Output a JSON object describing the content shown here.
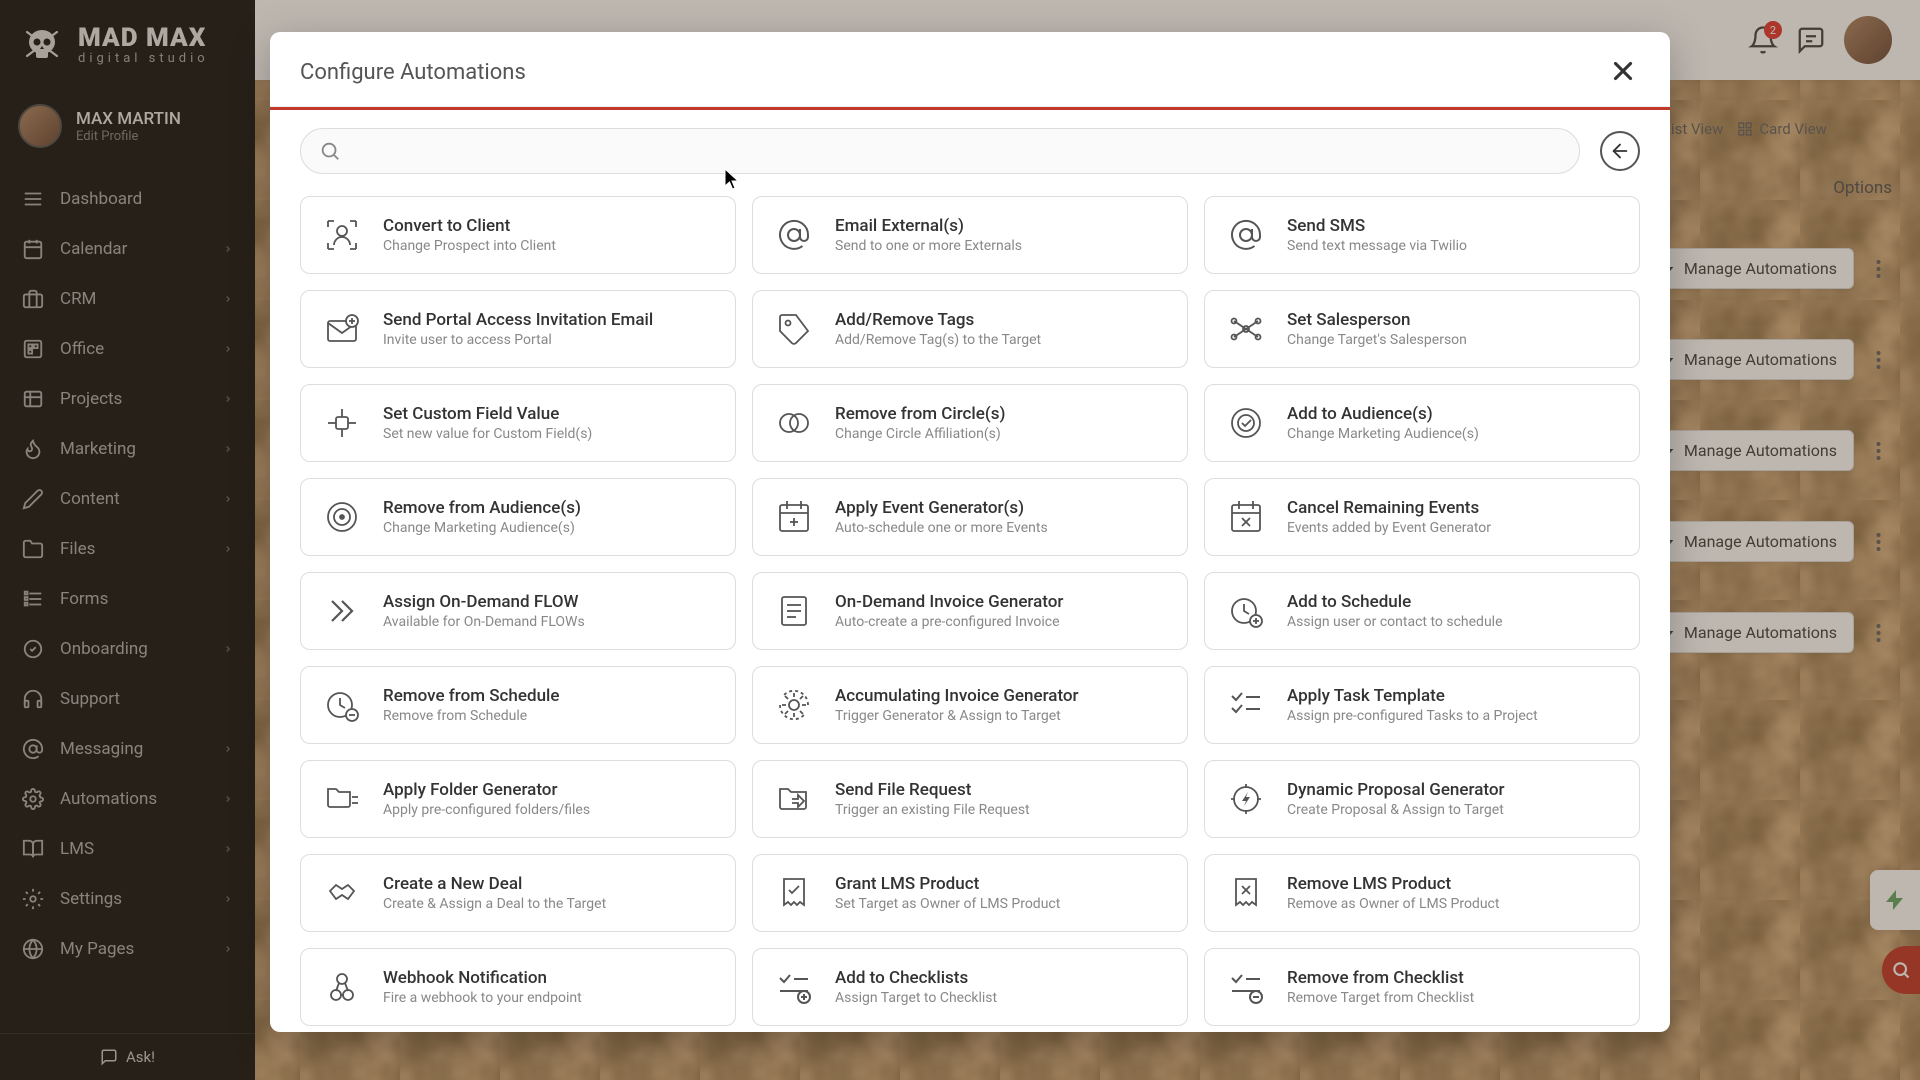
{
  "brand": {
    "name": "MAD MAX",
    "tagline": "digital studio"
  },
  "profile": {
    "name": "MAX MARTIN",
    "edit": "Edit Profile"
  },
  "sidebar": {
    "items": [
      {
        "label": "Dashboard",
        "icon": "menu",
        "chev": false
      },
      {
        "label": "Calendar",
        "icon": "calendar",
        "chev": true
      },
      {
        "label": "CRM",
        "icon": "crm",
        "chev": true
      },
      {
        "label": "Office",
        "icon": "office",
        "chev": true
      },
      {
        "label": "Projects",
        "icon": "projects",
        "chev": true
      },
      {
        "label": "Marketing",
        "icon": "flame",
        "chev": true
      },
      {
        "label": "Content",
        "icon": "pencil",
        "chev": true
      },
      {
        "label": "Files",
        "icon": "folder",
        "chev": true
      },
      {
        "label": "Forms",
        "icon": "forms",
        "chev": false
      },
      {
        "label": "Onboarding",
        "icon": "onboarding",
        "chev": true
      },
      {
        "label": "Support",
        "icon": "headset",
        "chev": false
      },
      {
        "label": "Messaging",
        "icon": "at",
        "chev": true
      },
      {
        "label": "Automations",
        "icon": "gear",
        "chev": true
      },
      {
        "label": "LMS",
        "icon": "book",
        "chev": true
      },
      {
        "label": "Settings",
        "icon": "cog",
        "chev": true
      },
      {
        "label": "My Pages",
        "icon": "globe",
        "chev": true
      }
    ],
    "ask": "Ask!"
  },
  "topbar": {
    "notif_count": "2"
  },
  "background_list": {
    "list_view": "List View",
    "card_view": "Card View",
    "options": "Options",
    "manage": "Manage Automations"
  },
  "modal": {
    "title": "Configure Automations",
    "search_placeholder": "",
    "cards": [
      {
        "title": "Convert to Client",
        "desc": "Change Prospect into Client",
        "icon": "user-convert"
      },
      {
        "title": "Email External(s)",
        "desc": "Send to one or more Externals",
        "icon": "at"
      },
      {
        "title": "Send SMS",
        "desc": "Send text message via Twilio",
        "icon": "at"
      },
      {
        "title": "Send Portal Access Invitation Email",
        "desc": "Invite user to access Portal",
        "icon": "mail-plus"
      },
      {
        "title": "Add/Remove Tags",
        "desc": "Add/Remove Tag(s) to the Target",
        "icon": "tag"
      },
      {
        "title": "Set Salesperson",
        "desc": "Change Target's Salesperson",
        "icon": "nodes"
      },
      {
        "title": "Set Custom Field Value",
        "desc": "Set new value for Custom Field(s)",
        "icon": "field"
      },
      {
        "title": "Remove from Circle(s)",
        "desc": "Change Circle Affiliation(s)",
        "icon": "circles"
      },
      {
        "title": "Add to Audience(s)",
        "desc": "Change Marketing Audience(s)",
        "icon": "target-check"
      },
      {
        "title": "Remove from Audience(s)",
        "desc": "Change Marketing Audience(s)",
        "icon": "target"
      },
      {
        "title": "Apply Event Generator(s)",
        "desc": "Auto-schedule one or more Events",
        "icon": "calendar-plus"
      },
      {
        "title": "Cancel Remaining Events",
        "desc": "Events added by Event Generator",
        "icon": "calendar-x"
      },
      {
        "title": "Assign On-Demand FLOW",
        "desc": "Available for On-Demand FLOWs",
        "icon": "chevrons"
      },
      {
        "title": "On-Demand Invoice Generator",
        "desc": "Auto-create a pre-configured Invoice",
        "icon": "invoice"
      },
      {
        "title": "Add to Schedule",
        "desc": "Assign user or contact to schedule",
        "icon": "clock-plus"
      },
      {
        "title": "Remove from Schedule",
        "desc": "Remove from Schedule",
        "icon": "clock-minus"
      },
      {
        "title": "Accumulating Invoice Generator",
        "desc": "Trigger Generator & Assign to Target",
        "icon": "gear-cycle"
      },
      {
        "title": "Apply Task Template",
        "desc": "Assign pre-configured Tasks to a Project",
        "icon": "checklist"
      },
      {
        "title": "Apply Folder Generator",
        "desc": "Apply pre-configured folders/files",
        "icon": "folder-tree"
      },
      {
        "title": "Send File Request",
        "desc": "Trigger an existing File Request",
        "icon": "folder-send"
      },
      {
        "title": "Dynamic Proposal Generator",
        "desc": "Create Proposal & Assign to Target",
        "icon": "gear-bolt"
      },
      {
        "title": "Create a New Deal",
        "desc": "Create & Assign a Deal to the Target",
        "icon": "handshake"
      },
      {
        "title": "Grant LMS Product",
        "desc": "Set Target as Owner of LMS Product",
        "icon": "receipt-check"
      },
      {
        "title": "Remove LMS Product",
        "desc": "Remove as Owner of LMS Product",
        "icon": "receipt-x"
      },
      {
        "title": "Webhook Notification",
        "desc": "Fire a webhook to your endpoint",
        "icon": "webhook"
      },
      {
        "title": "Add to Checklists",
        "desc": "Assign Target to Checklist",
        "icon": "checklist-add"
      },
      {
        "title": "Remove from Checklist",
        "desc": "Remove Target from Checklist",
        "icon": "checklist-remove"
      }
    ]
  }
}
